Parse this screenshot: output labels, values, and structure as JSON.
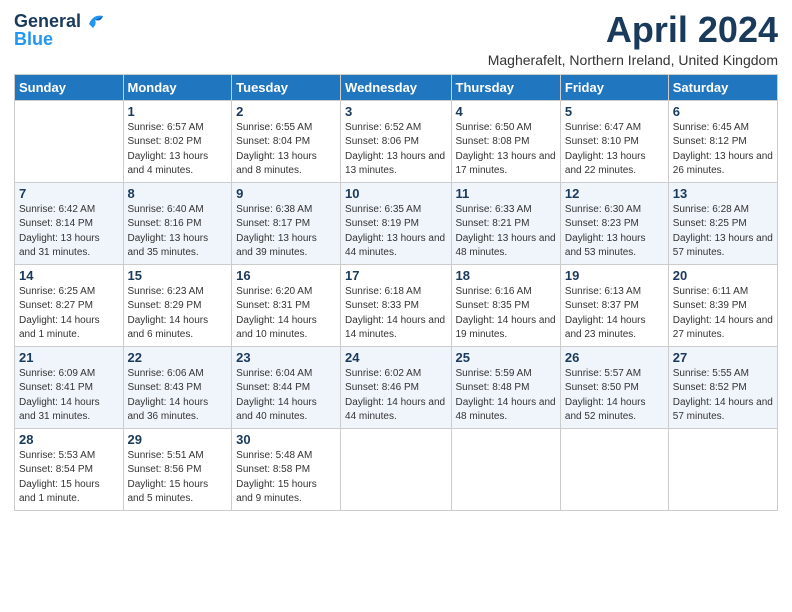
{
  "header": {
    "logo_general": "General",
    "logo_blue": "Blue",
    "month_title": "April 2024",
    "subtitle": "Magherafelt, Northern Ireland, United Kingdom"
  },
  "weekdays": [
    "Sunday",
    "Monday",
    "Tuesday",
    "Wednesday",
    "Thursday",
    "Friday",
    "Saturday"
  ],
  "weeks": [
    [
      null,
      {
        "day": "1",
        "sunrise": "Sunrise: 6:57 AM",
        "sunset": "Sunset: 8:02 PM",
        "daylight": "Daylight: 13 hours and 4 minutes."
      },
      {
        "day": "2",
        "sunrise": "Sunrise: 6:55 AM",
        "sunset": "Sunset: 8:04 PM",
        "daylight": "Daylight: 13 hours and 8 minutes."
      },
      {
        "day": "3",
        "sunrise": "Sunrise: 6:52 AM",
        "sunset": "Sunset: 8:06 PM",
        "daylight": "Daylight: 13 hours and 13 minutes."
      },
      {
        "day": "4",
        "sunrise": "Sunrise: 6:50 AM",
        "sunset": "Sunset: 8:08 PM",
        "daylight": "Daylight: 13 hours and 17 minutes."
      },
      {
        "day": "5",
        "sunrise": "Sunrise: 6:47 AM",
        "sunset": "Sunset: 8:10 PM",
        "daylight": "Daylight: 13 hours and 22 minutes."
      },
      {
        "day": "6",
        "sunrise": "Sunrise: 6:45 AM",
        "sunset": "Sunset: 8:12 PM",
        "daylight": "Daylight: 13 hours and 26 minutes."
      }
    ],
    [
      {
        "day": "7",
        "sunrise": "Sunrise: 6:42 AM",
        "sunset": "Sunset: 8:14 PM",
        "daylight": "Daylight: 13 hours and 31 minutes."
      },
      {
        "day": "8",
        "sunrise": "Sunrise: 6:40 AM",
        "sunset": "Sunset: 8:16 PM",
        "daylight": "Daylight: 13 hours and 35 minutes."
      },
      {
        "day": "9",
        "sunrise": "Sunrise: 6:38 AM",
        "sunset": "Sunset: 8:17 PM",
        "daylight": "Daylight: 13 hours and 39 minutes."
      },
      {
        "day": "10",
        "sunrise": "Sunrise: 6:35 AM",
        "sunset": "Sunset: 8:19 PM",
        "daylight": "Daylight: 13 hours and 44 minutes."
      },
      {
        "day": "11",
        "sunrise": "Sunrise: 6:33 AM",
        "sunset": "Sunset: 8:21 PM",
        "daylight": "Daylight: 13 hours and 48 minutes."
      },
      {
        "day": "12",
        "sunrise": "Sunrise: 6:30 AM",
        "sunset": "Sunset: 8:23 PM",
        "daylight": "Daylight: 13 hours and 53 minutes."
      },
      {
        "day": "13",
        "sunrise": "Sunrise: 6:28 AM",
        "sunset": "Sunset: 8:25 PM",
        "daylight": "Daylight: 13 hours and 57 minutes."
      }
    ],
    [
      {
        "day": "14",
        "sunrise": "Sunrise: 6:25 AM",
        "sunset": "Sunset: 8:27 PM",
        "daylight": "Daylight: 14 hours and 1 minute."
      },
      {
        "day": "15",
        "sunrise": "Sunrise: 6:23 AM",
        "sunset": "Sunset: 8:29 PM",
        "daylight": "Daylight: 14 hours and 6 minutes."
      },
      {
        "day": "16",
        "sunrise": "Sunrise: 6:20 AM",
        "sunset": "Sunset: 8:31 PM",
        "daylight": "Daylight: 14 hours and 10 minutes."
      },
      {
        "day": "17",
        "sunrise": "Sunrise: 6:18 AM",
        "sunset": "Sunset: 8:33 PM",
        "daylight": "Daylight: 14 hours and 14 minutes."
      },
      {
        "day": "18",
        "sunrise": "Sunrise: 6:16 AM",
        "sunset": "Sunset: 8:35 PM",
        "daylight": "Daylight: 14 hours and 19 minutes."
      },
      {
        "day": "19",
        "sunrise": "Sunrise: 6:13 AM",
        "sunset": "Sunset: 8:37 PM",
        "daylight": "Daylight: 14 hours and 23 minutes."
      },
      {
        "day": "20",
        "sunrise": "Sunrise: 6:11 AM",
        "sunset": "Sunset: 8:39 PM",
        "daylight": "Daylight: 14 hours and 27 minutes."
      }
    ],
    [
      {
        "day": "21",
        "sunrise": "Sunrise: 6:09 AM",
        "sunset": "Sunset: 8:41 PM",
        "daylight": "Daylight: 14 hours and 31 minutes."
      },
      {
        "day": "22",
        "sunrise": "Sunrise: 6:06 AM",
        "sunset": "Sunset: 8:43 PM",
        "daylight": "Daylight: 14 hours and 36 minutes."
      },
      {
        "day": "23",
        "sunrise": "Sunrise: 6:04 AM",
        "sunset": "Sunset: 8:44 PM",
        "daylight": "Daylight: 14 hours and 40 minutes."
      },
      {
        "day": "24",
        "sunrise": "Sunrise: 6:02 AM",
        "sunset": "Sunset: 8:46 PM",
        "daylight": "Daylight: 14 hours and 44 minutes."
      },
      {
        "day": "25",
        "sunrise": "Sunrise: 5:59 AM",
        "sunset": "Sunset: 8:48 PM",
        "daylight": "Daylight: 14 hours and 48 minutes."
      },
      {
        "day": "26",
        "sunrise": "Sunrise: 5:57 AM",
        "sunset": "Sunset: 8:50 PM",
        "daylight": "Daylight: 14 hours and 52 minutes."
      },
      {
        "day": "27",
        "sunrise": "Sunrise: 5:55 AM",
        "sunset": "Sunset: 8:52 PM",
        "daylight": "Daylight: 14 hours and 57 minutes."
      }
    ],
    [
      {
        "day": "28",
        "sunrise": "Sunrise: 5:53 AM",
        "sunset": "Sunset: 8:54 PM",
        "daylight": "Daylight: 15 hours and 1 minute."
      },
      {
        "day": "29",
        "sunrise": "Sunrise: 5:51 AM",
        "sunset": "Sunset: 8:56 PM",
        "daylight": "Daylight: 15 hours and 5 minutes."
      },
      {
        "day": "30",
        "sunrise": "Sunrise: 5:48 AM",
        "sunset": "Sunset: 8:58 PM",
        "daylight": "Daylight: 15 hours and 9 minutes."
      },
      null,
      null,
      null,
      null
    ]
  ]
}
